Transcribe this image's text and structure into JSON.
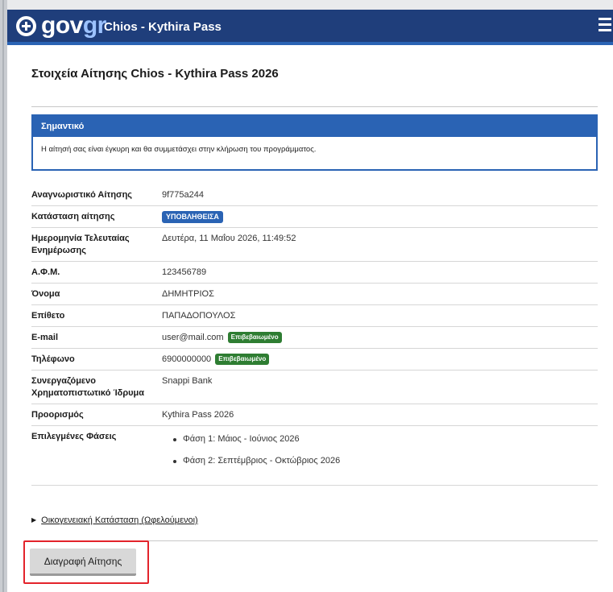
{
  "header": {
    "brand_main": "gov",
    "brand_accent": "gr",
    "app_title": "Chios - Kythira Pass",
    "bg_color": "#1f3e7b",
    "accent_color": "#2a63b4",
    "menu_icon": "hamburger-icon"
  },
  "page": {
    "title": "Στοιχεία Αίτησης Chios - Kythira Pass 2026"
  },
  "notice": {
    "heading": "Σημαντικό",
    "text": "Η αίτησή σας είναι έγκυρη και θα συμμετάσχει στην κλήρωση του προγράμματος."
  },
  "details": {
    "id_label": "Αναγνωριστικό Αίτησης",
    "id_value": "9f775a244",
    "status_label": "Κατάσταση αίτησης",
    "status_value": "ΥΠΟΒΛΗΘΕΙΣΑ",
    "updated_label": "Ημερομηνία Τελευταίας Ενημέρωσης",
    "updated_value": "Δευτέρα, 11 Μαΐου 2026, 11:49:52",
    "afm_label": "Α.Φ.Μ.",
    "afm_value": "123456789",
    "name_label": "Όνομα",
    "name_value": "ΔΗΜΗΤΡΙΟΣ",
    "surname_label": "Επίθετο",
    "surname_value": "ΠΑΠΑΔΟΠΟΥΛΟΣ",
    "email_label": "E-mail",
    "email_value": "user@mail.com",
    "email_badge": "Επιβεβαιωμένο",
    "phone_label": "Τηλέφωνο",
    "phone_value": "6900000000",
    "phone_badge": "Επιβεβαιωμένο",
    "bank_label": "Συνεργαζόμενο Χρηματοπιστωτικό Ίδρυμα",
    "bank_value": "Snappi Bank",
    "destination_label": "Προορισμός",
    "destination_value": "Kythira Pass 2026",
    "phases_label": "Επιλεγμένες Φάσεις",
    "phases": [
      "Φάση 1: Μάιος - Ιούνιος 2026",
      "Φάση 2: Σεπτέμβριος - Οκτώβριος 2026"
    ]
  },
  "family": {
    "label": "Οικογενειακή Κατάσταση (Ωφελούμενοι)"
  },
  "actions": {
    "delete_label": "Διαγραφή Αίτησης",
    "highlight_color": "#e3232b"
  }
}
